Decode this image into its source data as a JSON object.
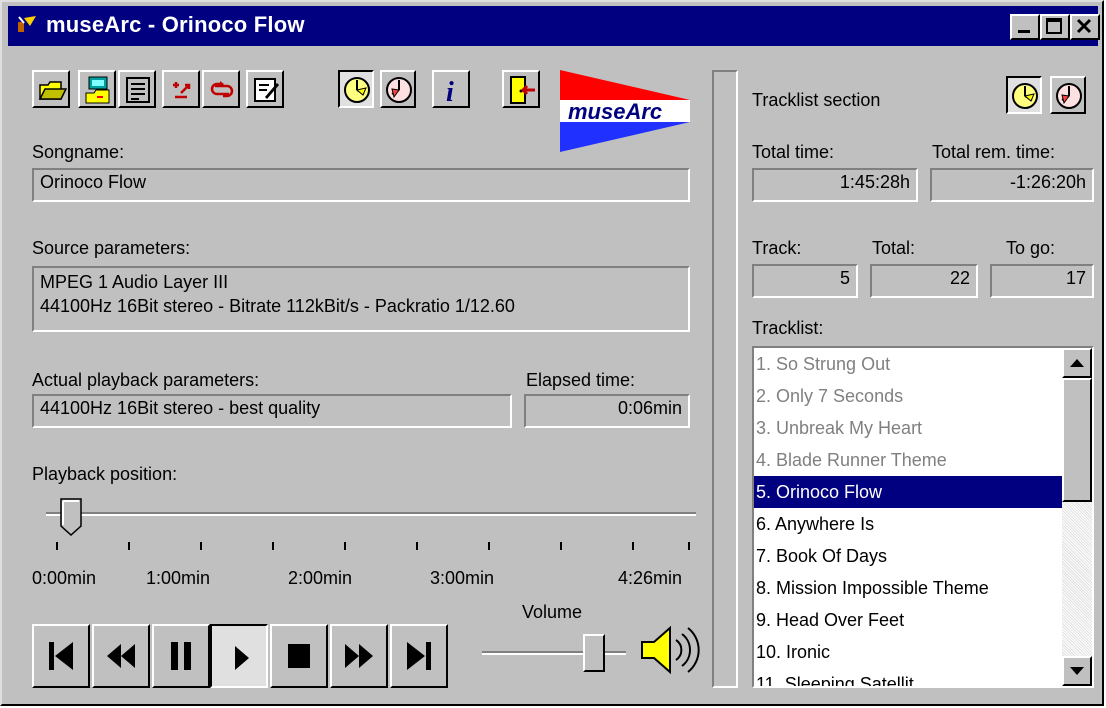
{
  "window": {
    "title": "museArc - Orinoco Flow",
    "controls": [
      "minimize",
      "maximize",
      "close"
    ]
  },
  "toolbar": {
    "buttons": [
      {
        "name": "open-folder-icon"
      },
      {
        "name": "open-network-icon"
      },
      {
        "name": "playlist-editor-icon"
      },
      {
        "name": "shuffle-icon"
      },
      {
        "name": "repeat-icon"
      },
      {
        "name": "edit-tags-icon"
      },
      {
        "name": "elapsed-clock-icon",
        "pressed": true
      },
      {
        "name": "remaining-clock-icon"
      },
      {
        "name": "info-icon"
      },
      {
        "name": "exit-door-icon"
      }
    ],
    "logo_text": "museArc"
  },
  "song": {
    "label": "Songname:",
    "value": "Orinoco Flow"
  },
  "source": {
    "label": "Source parameters:",
    "line1": "MPEG 1 Audio Layer III",
    "line2": "44100Hz 16Bit stereo - Bitrate 112kBit/s - Packratio 1/12.60"
  },
  "playback": {
    "label": "Actual playback parameters:",
    "value": "44100Hz 16Bit stereo - best quality",
    "elapsed_label": "Elapsed time:",
    "elapsed_value": "0:06min"
  },
  "position": {
    "label": "Playback position:",
    "fraction": 0.023,
    "tick_labels": [
      "0:00min",
      "1:00min",
      "2:00min",
      "3:00min",
      "4:26min"
    ]
  },
  "transport": {
    "buttons": [
      "skip-start-icon",
      "rewind-icon",
      "pause-icon",
      "play-icon",
      "stop-icon",
      "fast-forward-icon",
      "skip-end-icon"
    ],
    "pressed": "play-icon"
  },
  "volume": {
    "label": "Volume",
    "level": 0.8
  },
  "tracklist_section": {
    "title": "Tracklist section",
    "total_time_label": "Total time:",
    "total_time_value": "1:45:28h",
    "total_rem_label": "Total rem. time:",
    "total_rem_value": "-1:26:20h",
    "track_label": "Track:",
    "track_value": "5",
    "total_label": "Total:",
    "total_value": "22",
    "togo_label": "To go:",
    "togo_value": "17",
    "list_label": "Tracklist:",
    "selected_index": 4,
    "tracks": [
      "1. So Strung Out",
      "2. Only 7 Seconds",
      "3. Unbreak My Heart",
      "4. Blade Runner Theme",
      "5. Orinoco Flow",
      "6. Anywhere Is",
      "7. Book Of Days",
      "8. Mission Impossible Theme",
      "9. Head Over Feet",
      "10. Ironic",
      "11. Sleeping Satellit"
    ]
  },
  "colors": {
    "window_bg": "#c0c0c0",
    "title_bar": "#000080",
    "selection": "#000080",
    "played_text": "#808080"
  }
}
